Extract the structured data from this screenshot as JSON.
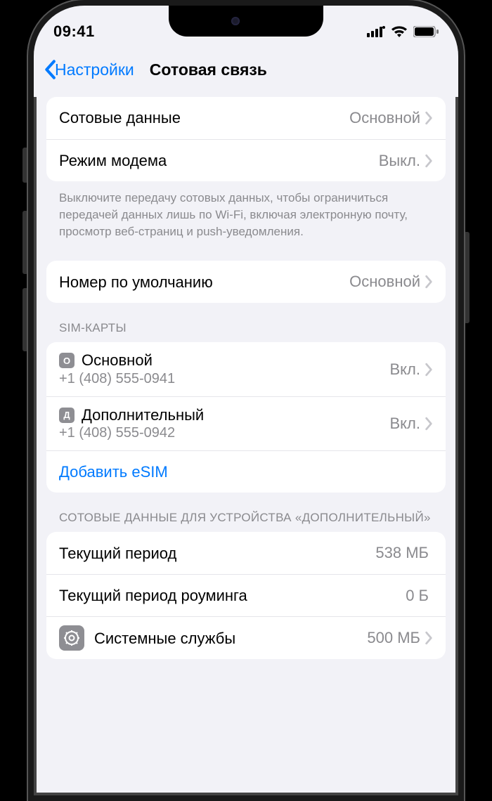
{
  "status": {
    "time": "09:41"
  },
  "nav": {
    "back": "Настройки",
    "title": "Сотовая связь"
  },
  "group1": {
    "cellular_data": {
      "label": "Сотовые данные",
      "value": "Основной"
    },
    "hotspot": {
      "label": "Режим модема",
      "value": "Выкл."
    },
    "footer": "Выключите передачу сотовых данных, чтобы ограничиться передачей данных лишь по Wi-Fi, включая электронную почту, просмотр веб-страниц и push-уведомления."
  },
  "group2": {
    "default_line": {
      "label": "Номер по умолчанию",
      "value": "Основной"
    }
  },
  "sims": {
    "header": "SIM-карты",
    "items": [
      {
        "badge": "О",
        "name": "Основной",
        "number": "+1 (408) 555-0941",
        "state": "Вкл."
      },
      {
        "badge": "Д",
        "name": "Дополнительный",
        "number": "+1 (408) 555-0942",
        "state": "Вкл."
      }
    ],
    "add_esim": "Добавить eSIM"
  },
  "usage": {
    "header": "Сотовые данные для устройства «Дополнительный»",
    "current_period": {
      "label": "Текущий период",
      "value": "538 МБ"
    },
    "current_period_roaming": {
      "label": "Текущий период роуминга",
      "value": "0 Б"
    },
    "system_services": {
      "label": "Системные службы",
      "value": "500 МБ"
    }
  }
}
